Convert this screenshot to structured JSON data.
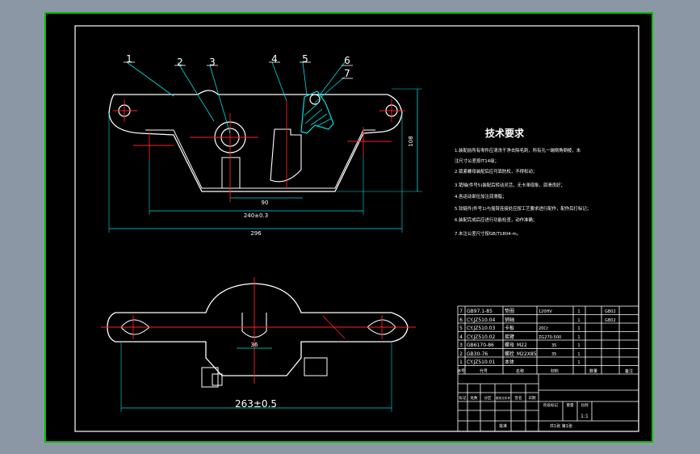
{
  "colors": {
    "background": "#8c97a5",
    "sheet": "#000000",
    "frame": "#00c000",
    "part_outline": "#ffffff",
    "center_line": "#ff2020",
    "dimension": "#00e0e0",
    "hatch": "#7fe6ff"
  },
  "balloons": [
    "1",
    "2",
    "3",
    "4",
    "5",
    "6",
    "7"
  ],
  "dimensions": {
    "bore_span": "90",
    "pin_span": "240±0.3",
    "overall_length": "296",
    "height": "108",
    "slot_width": "36",
    "base_length": "263±0.5"
  },
  "tech_requirements": {
    "title": "技术要求",
    "lines": [
      "1.装配前所有零件应清洗干净去除毛刺，所有孔一端倒角倒棱，未",
      "注尺寸公差按IT14级；",
      "2.锁紧螺母装配后应可靠防松，不得松动；",
      "3.销轴(件号5)装配后转动灵活，无卡滞现象，润滑良好；",
      "4.各运动部位加注润滑脂；",
      "5.铰链件(件号1)与摇臂连接处应按工艺要求进行配作，配作后打标记；",
      "6.装配完成后应进行功能检查，动作准确；",
      "7.未注公差尺寸按GB/T1804-m。"
    ]
  },
  "bom": [
    {
      "no": "7",
      "code": "GB97.1-85",
      "name": "垫圈",
      "qty": "",
      "material": "120HV",
      "weight": "1",
      "remark": "GB02"
    },
    {
      "no": "6",
      "code": "CY.JZ510.04",
      "name": "销轴",
      "qty": "",
      "material": "",
      "weight": "1",
      "remark": "GB02"
    },
    {
      "no": "5",
      "code": "CY.JZ510.03",
      "name": "卡板",
      "qty": "",
      "material": "20Cr",
      "weight": "1",
      "remark": ""
    },
    {
      "no": "4",
      "code": "CY.JZ510.02",
      "name": "摇臂",
      "qty": "",
      "material": "ZG270-500",
      "weight": "1",
      "remark": ""
    },
    {
      "no": "3",
      "code": "GB6170-86",
      "name": "螺母",
      "qty": "M22",
      "material": "35",
      "weight": "1",
      "remark": ""
    },
    {
      "no": "2",
      "code": "GB30-76",
      "name": "螺栓",
      "qty": "M22X85",
      "material": "35",
      "weight": "1",
      "remark": ""
    },
    {
      "no": "1",
      "code": "CY.JZ510.01",
      "name": "本体",
      "qty": "",
      "material": "",
      "weight": "1",
      "remark": ""
    }
  ],
  "bom_header": {
    "no": "序号",
    "code": "代号",
    "name": "名称",
    "material": "材料",
    "weight": "数量",
    "remark": "备注"
  },
  "title_block": {
    "marks": [
      "标记",
      "处数",
      "分区",
      "更改文件号",
      "签名",
      "日期"
    ],
    "stage": "阶段标记",
    "weight": "重量",
    "scale": "比例",
    "scale_value": "1:1",
    "sheet": "共1张 第1张",
    "approve": "批准"
  }
}
